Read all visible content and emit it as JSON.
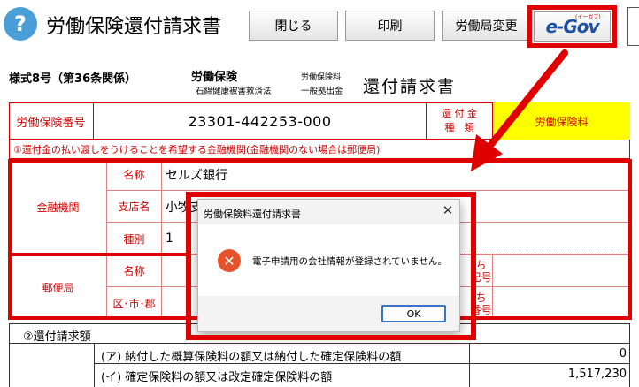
{
  "header": {
    "help_icon": "?",
    "title": "労働保険還付請求書",
    "buttons": {
      "close": "閉じる",
      "print": "印刷",
      "bureau_change": "労働局変更"
    },
    "egov_logo": "e-Gov",
    "egov_ruby": "(イーガブ)"
  },
  "form": {
    "form_no": "様式8号（第36条関係）",
    "label_hoken": "労働保険",
    "label_sekimen": "石綿健康被害救済法",
    "label_hokenryo": "労働保険料",
    "label_ippan": "一般拠出金",
    "title": "還付請求書",
    "hoken_no_label": "労働保険番号",
    "hoken_no_value": "23301-442253-000",
    "kanpu_type_label_1": "還 付 金",
    "kanpu_type_label_2": "種　類",
    "kanpu_type_value": "労働保険料",
    "notice": "①還付金の払い渡しをうけることを希望する金融機関(金融機関のない場合は郵便局)",
    "bank": {
      "group_label": "金融機関",
      "name_label": "名称",
      "name_value": "セルズ銀行",
      "branch_label": "支店名",
      "branch_value": "小牧支",
      "type_label": "種別",
      "type_value": "1"
    },
    "post": {
      "group_label": "郵便局",
      "name_label": "名称",
      "city_label": "区･市･郡",
      "frag_1": "ち",
      "frag_2": "記号",
      "frag_3": "ち",
      "frag_4": "番号"
    },
    "section2": {
      "title": "②還付請求額",
      "row1_label": "(ア) 納付した概算保険料の額又は納付した確定保険料の額",
      "row1_value": "0",
      "row2_label": "(イ) 確定保険料の額又は改定確定保険料の額",
      "row2_value": "1,517,230"
    }
  },
  "dialog": {
    "title": "労働保険料還付請求書",
    "close": "✕",
    "icon": "✕",
    "message": "電子申請用の会社情報が登録されていません。",
    "ok": "OK"
  },
  "colors": {
    "highlight": "#e00000",
    "form_red": "#d40000",
    "yellow": "#ffff00"
  }
}
